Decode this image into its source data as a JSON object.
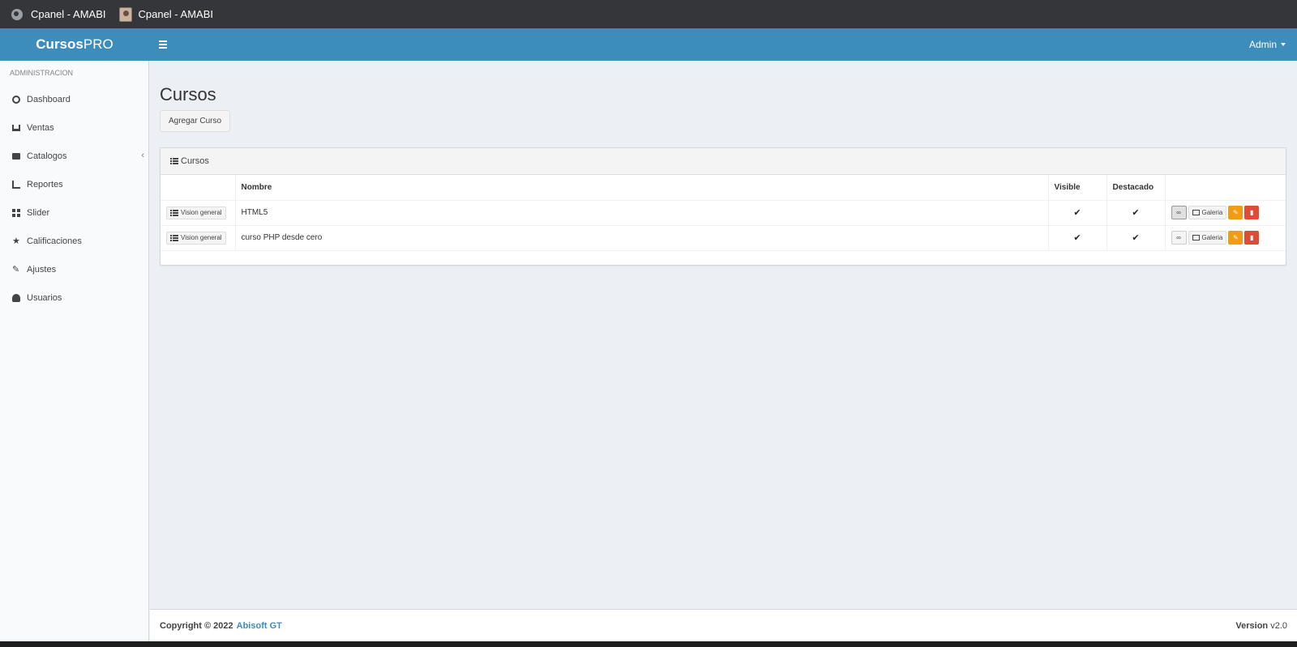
{
  "topbar": {
    "tabs": [
      {
        "title": "Cpanel - AMABI",
        "icon": "globe-icon"
      },
      {
        "title": "Cpanel - AMABI",
        "icon": "avatar-icon"
      }
    ]
  },
  "header": {
    "logo_bold": "Cursos",
    "logo_light": "PRO",
    "user_menu": "Admin",
    "brand_color": "#3c8dbc"
  },
  "sidebar": {
    "section_title": "ADMINISTRACION",
    "items": [
      {
        "label": "Dashboard",
        "icon": "dashboard-icon"
      },
      {
        "label": "Ventas",
        "icon": "cart-icon"
      },
      {
        "label": "Catalogos",
        "icon": "folder-icon"
      },
      {
        "label": "Reportes",
        "icon": "chart-icon"
      },
      {
        "label": "Slider",
        "icon": "grid-icon"
      },
      {
        "label": "Calificaciones",
        "icon": "star-icon"
      },
      {
        "label": "Ajustes",
        "icon": "wrench-icon"
      },
      {
        "label": "Usuarios",
        "icon": "user-icon"
      }
    ],
    "collapse_glyph": "‹"
  },
  "main": {
    "page_title": "Cursos",
    "add_button": "Agregar Curso",
    "box_title": "Cursos",
    "table": {
      "headers": [
        "",
        "Nombre",
        "Visible",
        "Destacado",
        ""
      ],
      "rows": [
        {
          "overview": "Vision general",
          "name": "HTML5",
          "visible": "✔",
          "featured": "✔",
          "gallery": "Galeria"
        },
        {
          "overview": "Vision general",
          "name": "curso PHP desde cero",
          "visible": "✔",
          "featured": "✔",
          "gallery": "Galeria"
        }
      ]
    }
  },
  "footer": {
    "copyright": "Copyright © 2022",
    "company": "Abisoft GT",
    "version_label": "Version",
    "version": "v2.0"
  }
}
